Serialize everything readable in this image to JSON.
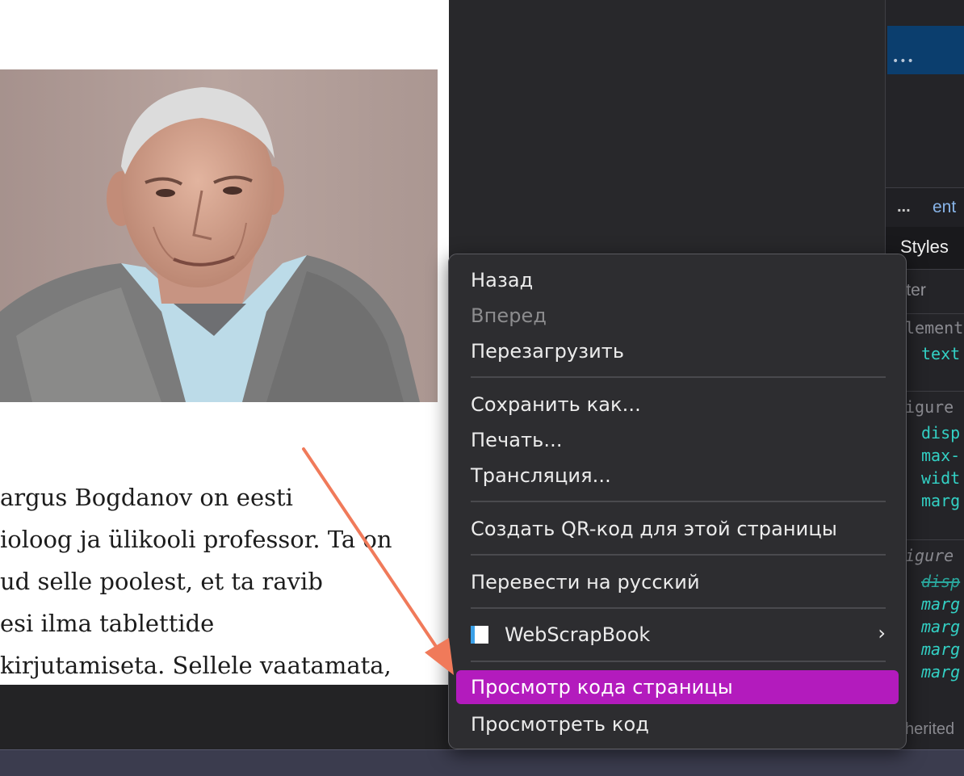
{
  "article": {
    "lines": [
      "argus Bogdanov on eesti",
      "ioloog ja ülikooli professor. Ta on",
      "ud selle poolest, et ta ravib",
      "esi ilma tablettide",
      "kirjutamiseta. Sellele vaatamata,"
    ]
  },
  "devtools": {
    "selected_dots": "•••",
    "breadcrumb_dots": "...",
    "breadcrumb_text": "ent",
    "tab_styles": "Styles",
    "filter_placeholder": "ilter",
    "rules": [
      {
        "selector": "lement",
        "props": [
          "text"
        ]
      },
      {
        "selector": "igure",
        "props": [
          "disp",
          "max-",
          "widt",
          "marg"
        ]
      },
      {
        "selector": "igure",
        "props": [
          "disp",
          "marg",
          "marg",
          "marg",
          "marg"
        ]
      }
    ],
    "inherited_label": "herited"
  },
  "context_menu": {
    "back": "Назад",
    "forward": "Вперед",
    "reload": "Перезагрузить",
    "save_as": "Сохранить как...",
    "print": "Печать...",
    "cast": "Трансляция...",
    "qr": "Создать QR-код для этой страницы",
    "translate": "Перевести на русский",
    "extension": "WebScrapBook",
    "view_source": "Просмотр кода страницы",
    "inspect": "Просмотреть код"
  },
  "colors": {
    "highlight": "#b31bbd",
    "annotation_arrow": "#f07a5a",
    "devtools_property": "#33d1c5"
  }
}
